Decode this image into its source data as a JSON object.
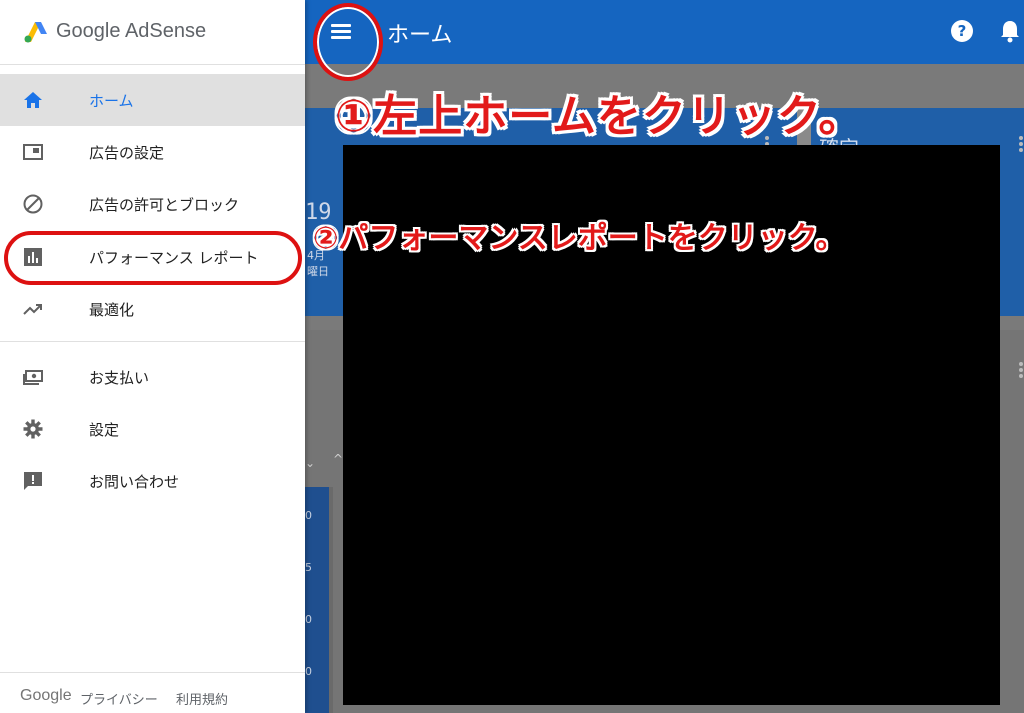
{
  "brand": {
    "google": "Google",
    "product": "AdSense"
  },
  "topbar": {
    "title": "ホーム"
  },
  "nav": {
    "items": [
      {
        "label": "ホーム",
        "icon": "home-icon",
        "active": true
      },
      {
        "label": "広告の設定",
        "icon": "ad-unit-icon"
      },
      {
        "label": "広告の許可とブロック",
        "icon": "block-icon"
      },
      {
        "label": "パフォーマンス レポート",
        "icon": "bar-chart-icon"
      },
      {
        "label": "最適化",
        "icon": "trending-up-icon"
      },
      {
        "label": "お支払い",
        "icon": "payments-icon"
      },
      {
        "label": "設定",
        "icon": "gear-icon"
      },
      {
        "label": "お問い合わせ",
        "icon": "feedback-icon"
      }
    ]
  },
  "footer": {
    "google": "Google",
    "privacy": "プライバシー",
    "terms": "利用規約"
  },
  "annotations": {
    "step1": "①左上ホームをクリック。",
    "step2": "②パフォーマンスレポートをクリック。"
  },
  "background": {
    "card_number": "19",
    "card_sub1": "4月",
    "card_sub2": "曜日",
    "card_right_title": "確定",
    "row_labels": [
      "0",
      "5",
      "0",
      "0"
    ]
  },
  "colors": {
    "accent": "#1565c0",
    "active_text": "#1a73e8",
    "annotation": "#e21a1a"
  }
}
